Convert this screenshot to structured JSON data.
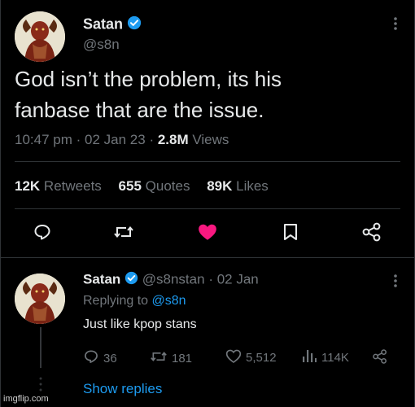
{
  "tweet": {
    "author_name": "Satan",
    "author_handle": "@s8n",
    "text_line1": "God isn’t the problem, its his",
    "text_line2": "fanbase that are the issue.",
    "time": "10:47 pm",
    "date": "02 Jan 23",
    "views_count": "2.8M",
    "views_label": "Views",
    "stats": {
      "retweets_count": "12K",
      "retweets_label": "Retweets",
      "quotes_count": "655",
      "quotes_label": "Quotes",
      "likes_count": "89K",
      "likes_label": "Likes"
    },
    "liked": true
  },
  "reply": {
    "author_name": "Satan",
    "author_handle": "@s8nstan",
    "date": "02 Jan",
    "replying_prefix": "Replying to",
    "replying_to": "@s8n",
    "text": "Just like kpop stans",
    "replies": "36",
    "retweets": "181",
    "likes": "5,512",
    "views": "114K"
  },
  "show_replies_label": "Show replies",
  "watermark": "imgflip.com",
  "icons": [
    "more-icon",
    "verified-icon",
    "reply-icon",
    "retweet-icon",
    "like-icon",
    "bookmark-icon",
    "share-icon",
    "views-icon"
  ],
  "colors": {
    "background": "#000000",
    "text": "#e7e9ea",
    "muted": "#71767b",
    "link": "#1d9bf0",
    "like": "#f91880"
  }
}
